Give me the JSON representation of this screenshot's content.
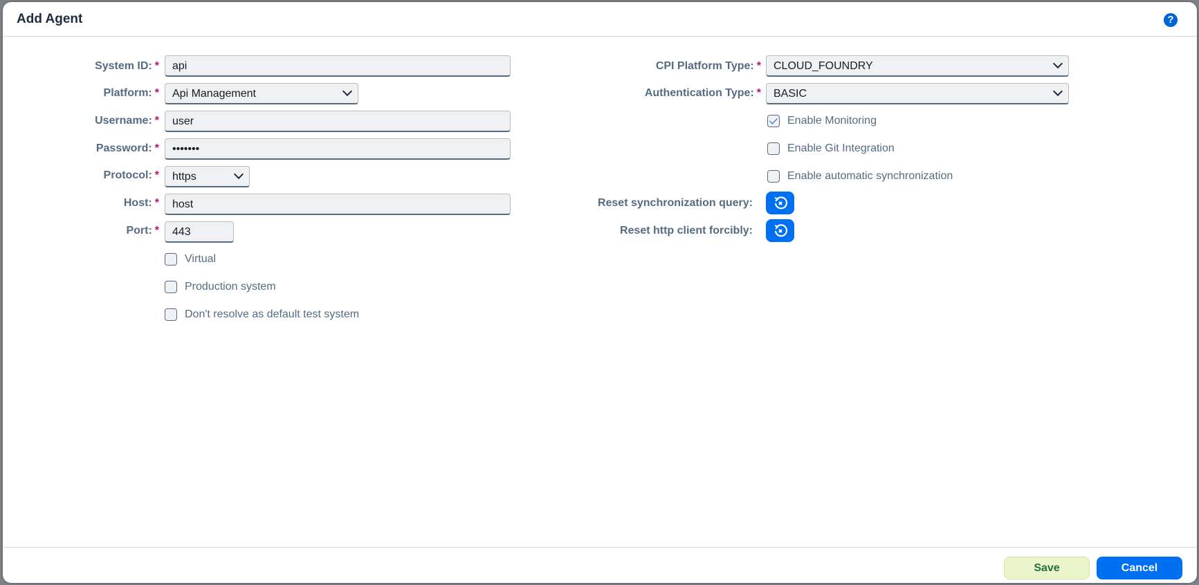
{
  "dialog": {
    "title": "Add Agent",
    "help_icon": "question-circle-icon"
  },
  "left": {
    "system_id": {
      "label": "System ID:",
      "value": "api"
    },
    "platform": {
      "label": "Platform:",
      "value": "Api Management"
    },
    "username": {
      "label": "Username:",
      "value": "user"
    },
    "password": {
      "label": "Password:",
      "value": "•••••••"
    },
    "protocol": {
      "label": "Protocol:",
      "value": "https"
    },
    "host": {
      "label": "Host:",
      "value": "host"
    },
    "port": {
      "label": "Port:",
      "value": "443"
    },
    "required_mark": "*",
    "checkboxes": [
      {
        "label": "Virtual",
        "checked": false
      },
      {
        "label": "Production system",
        "checked": false
      },
      {
        "label": "Don't resolve as default test system",
        "checked": false
      }
    ]
  },
  "right": {
    "cpi_platform_type": {
      "label": "CPI Platform Type:",
      "value": "CLOUD_FOUNDRY"
    },
    "authentication_type": {
      "label": "Authentication Type:",
      "value": "BASIC"
    },
    "checkboxes": [
      {
        "label": "Enable Monitoring",
        "checked": true
      },
      {
        "label": "Enable Git Integration",
        "checked": false
      },
      {
        "label": "Enable automatic synchronization",
        "checked": false
      }
    ],
    "reset_sync_query": {
      "label": "Reset synchronization query:"
    },
    "reset_http_client": {
      "label": "Reset http client forcibly:"
    }
  },
  "footer": {
    "save": "Save",
    "cancel": "Cancel"
  },
  "colors": {
    "accent": "#0070f2",
    "save_bg": "#ebf5cb",
    "required": "#c0106a"
  }
}
